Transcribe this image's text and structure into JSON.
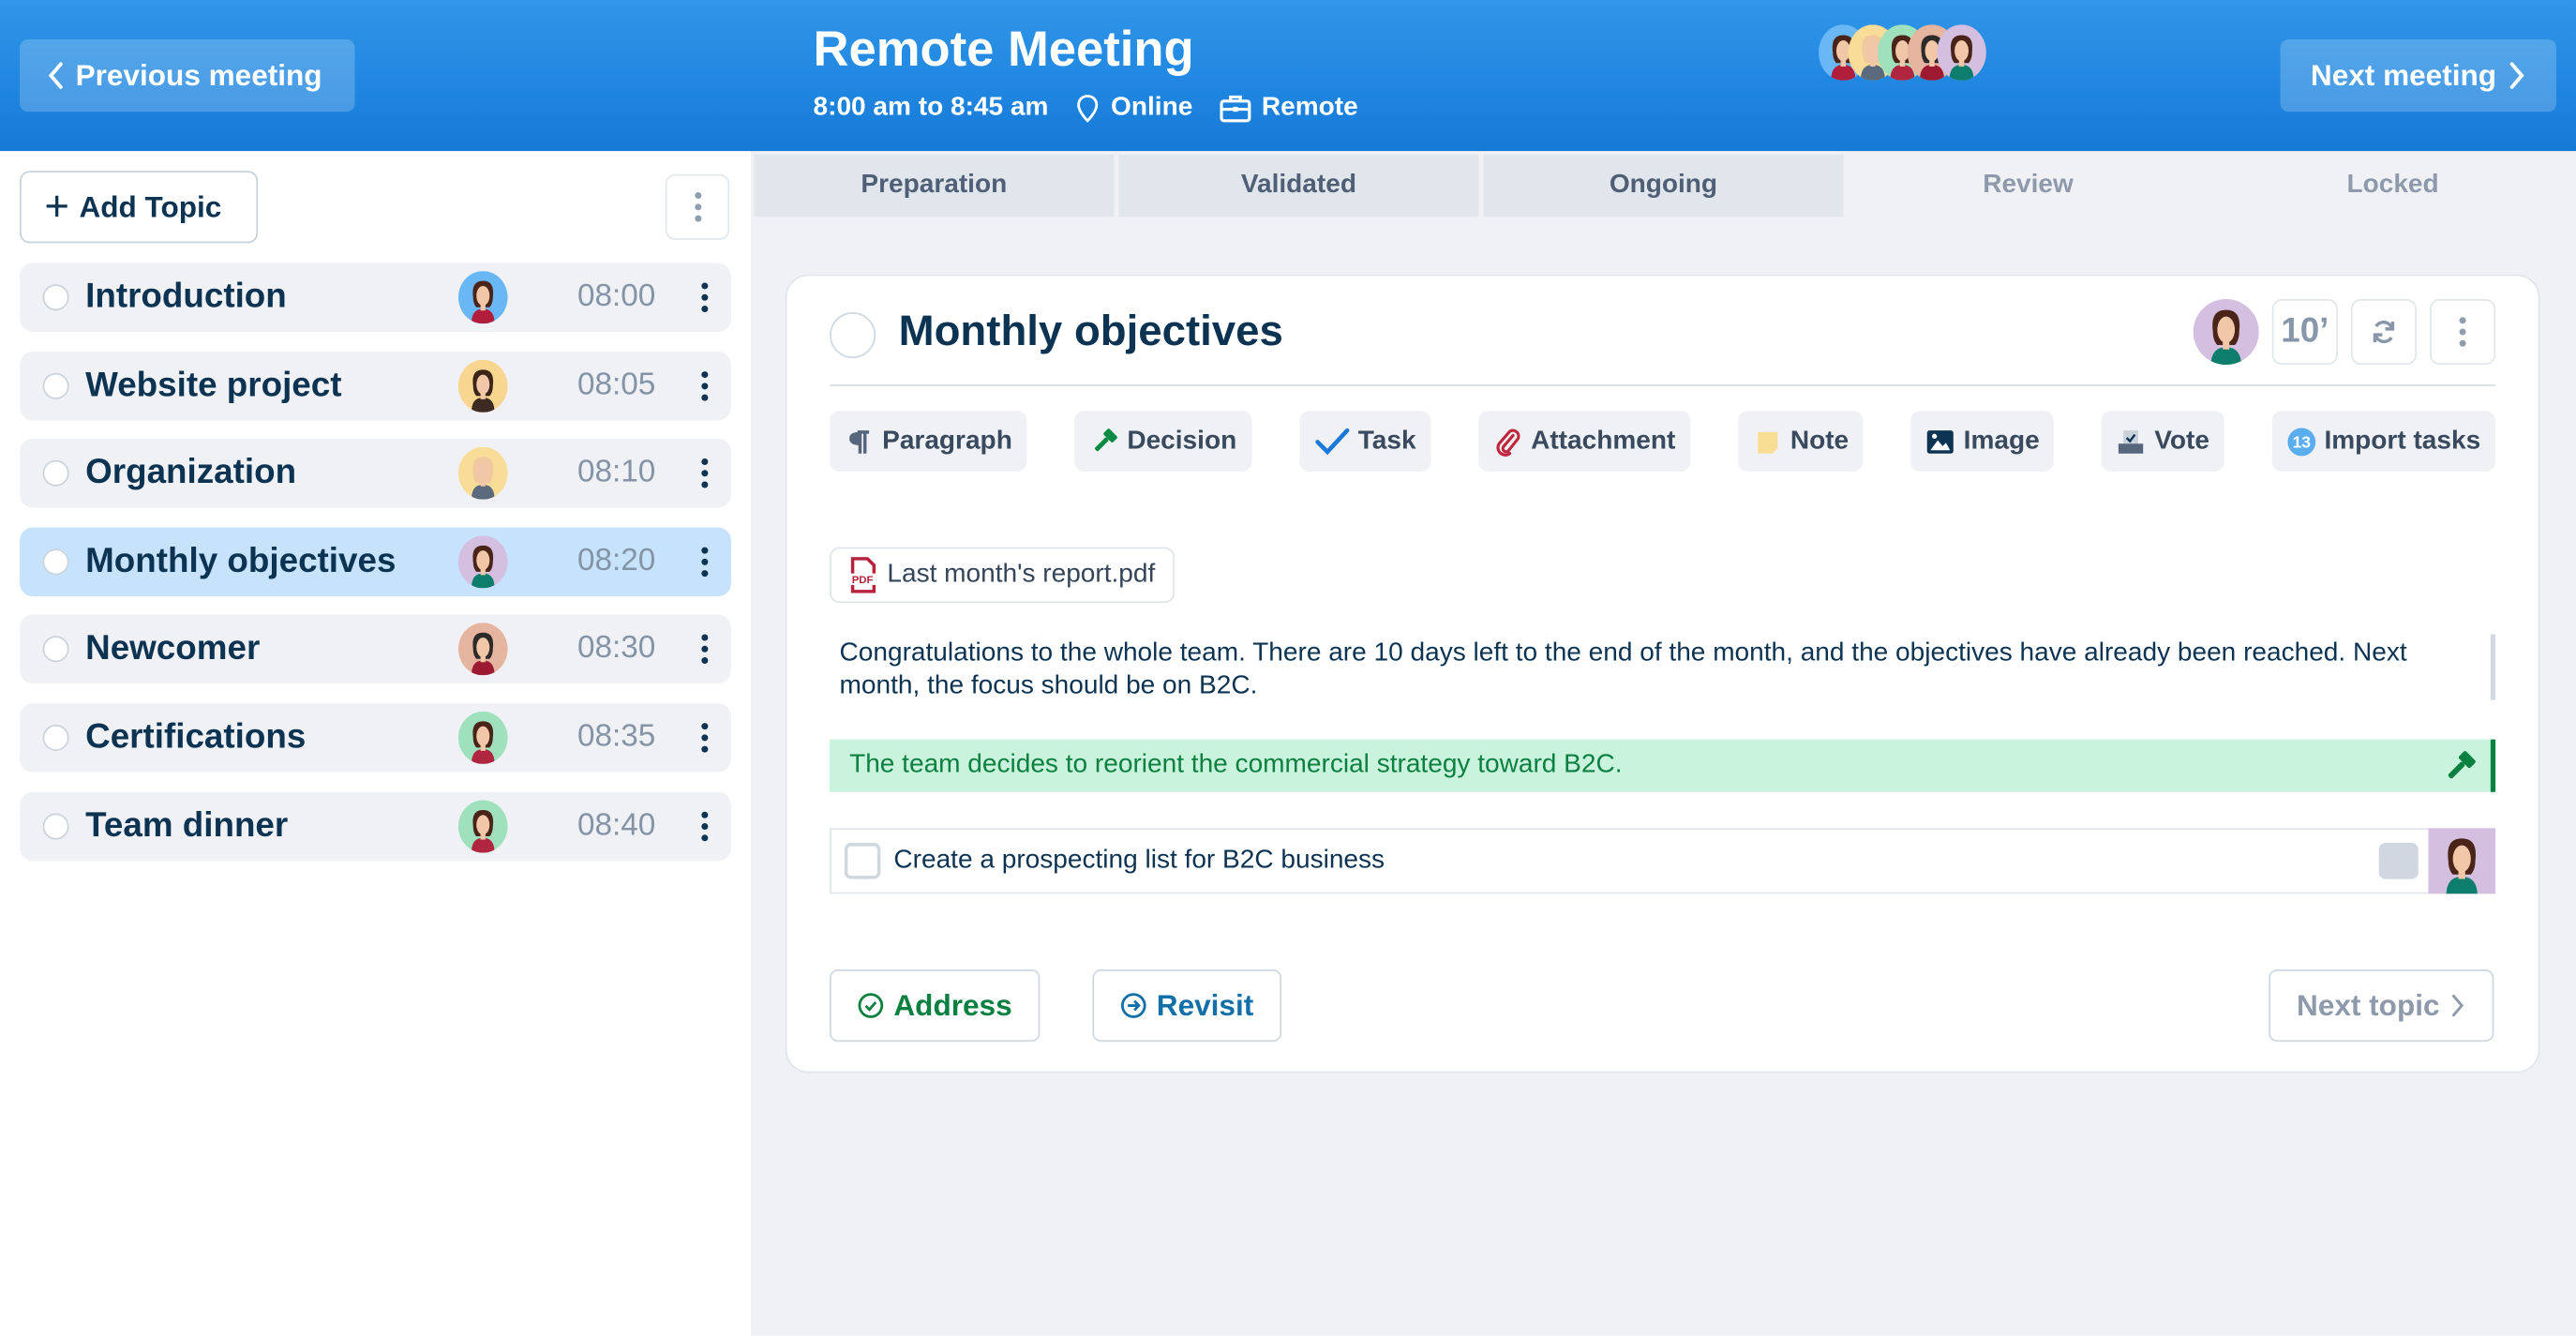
{
  "header": {
    "prev_label": "Previous meeting",
    "next_label": "Next meeting",
    "title": "Remote Meeting",
    "time_range": "8:00 am to 8:45 am",
    "location": "Online",
    "category": "Remote",
    "participants": [
      {
        "bg": "#6ab7f5",
        "hair": "#4a2418",
        "shirt": "#b01e3c"
      },
      {
        "bg": "#f8dc98",
        "hair": "#f0c9a0",
        "shirt": "#5b6a7d"
      },
      {
        "bg": "#9fe0bd",
        "hair": "#4a2418",
        "shirt": "#b0253f"
      },
      {
        "bg": "#e6b5a0",
        "hair": "#2d2a2a",
        "shirt": "#9c1b32"
      },
      {
        "bg": "#d4bfe0",
        "hair": "#4a2418",
        "shirt": "#0d7d6e"
      }
    ]
  },
  "sidebar": {
    "add_topic_label": "Add Topic",
    "topics": [
      {
        "name": "Introduction",
        "time": "08:00",
        "active": false,
        "avatar": {
          "bg": "#6ab7f5",
          "hair": "#4a2418",
          "shirt": "#b01e3c"
        }
      },
      {
        "name": "Website project",
        "time": "08:05",
        "active": false,
        "avatar": {
          "bg": "#f8d68f",
          "hair": "#3b2418",
          "shirt": "#3d2a22"
        }
      },
      {
        "name": "Organization",
        "time": "08:10",
        "active": false,
        "avatar": {
          "bg": "#f8dc98",
          "hair": "#f0c9a0",
          "shirt": "#5b6a7d"
        }
      },
      {
        "name": "Monthly objectives",
        "time": "08:20",
        "active": true,
        "avatar": {
          "bg": "#d4bfe0",
          "hair": "#4a2418",
          "shirt": "#0d7d6e"
        }
      },
      {
        "name": "Newcomer",
        "time": "08:30",
        "active": false,
        "avatar": {
          "bg": "#e6b5a0",
          "hair": "#2d2a2a",
          "shirt": "#9c1b32"
        }
      },
      {
        "name": "Certifications",
        "time": "08:35",
        "active": false,
        "avatar": {
          "bg": "#9fe0bd",
          "hair": "#4a2418",
          "shirt": "#b0253f"
        }
      },
      {
        "name": "Team dinner",
        "time": "08:40",
        "active": false,
        "avatar": {
          "bg": "#9fe0bd",
          "hair": "#4a2418",
          "shirt": "#b0253f"
        }
      }
    ]
  },
  "tabs": [
    {
      "label": "Preparation",
      "enabled": true
    },
    {
      "label": "Validated",
      "enabled": true
    },
    {
      "label": "Ongoing",
      "enabled": true
    },
    {
      "label": "Review",
      "enabled": false
    },
    {
      "label": "Locked",
      "enabled": false
    }
  ],
  "topic": {
    "title": "Monthly objectives",
    "duration": "10’",
    "owner_avatar": {
      "bg": "#d4bfe0",
      "hair": "#4a2418",
      "shirt": "#0d7d6e"
    },
    "toolbar": {
      "paragraph": "Paragraph",
      "decision": "Decision",
      "task": "Task",
      "attachment": "Attachment",
      "note": "Note",
      "image": "Image",
      "vote": "Vote",
      "import_tasks": "Import tasks",
      "import_count": "13"
    },
    "attachment": {
      "filename": "Last month's report.pdf",
      "icon_label": "PDF"
    },
    "paragraph_text": "Congratulations to the whole team. There are 10 days left to the end of the month, and the objectives have already been reached. Next month, the focus should be on B2C.",
    "decision_text": "The team decides to reorient the commercial strategy toward B2C.",
    "task": {
      "label": "Create a prospecting list for B2C business",
      "done": false
    },
    "actions": {
      "address": "Address",
      "revisit": "Revisit",
      "next_topic": "Next topic"
    }
  },
  "colors": {
    "header_blue": "#2a8fe5",
    "active_topic": "#c6e3fb",
    "decision_bg": "#c9f3dc",
    "decision_text": "#0a8040",
    "revisit_blue": "#136fa8",
    "title_navy": "#0d3352"
  }
}
